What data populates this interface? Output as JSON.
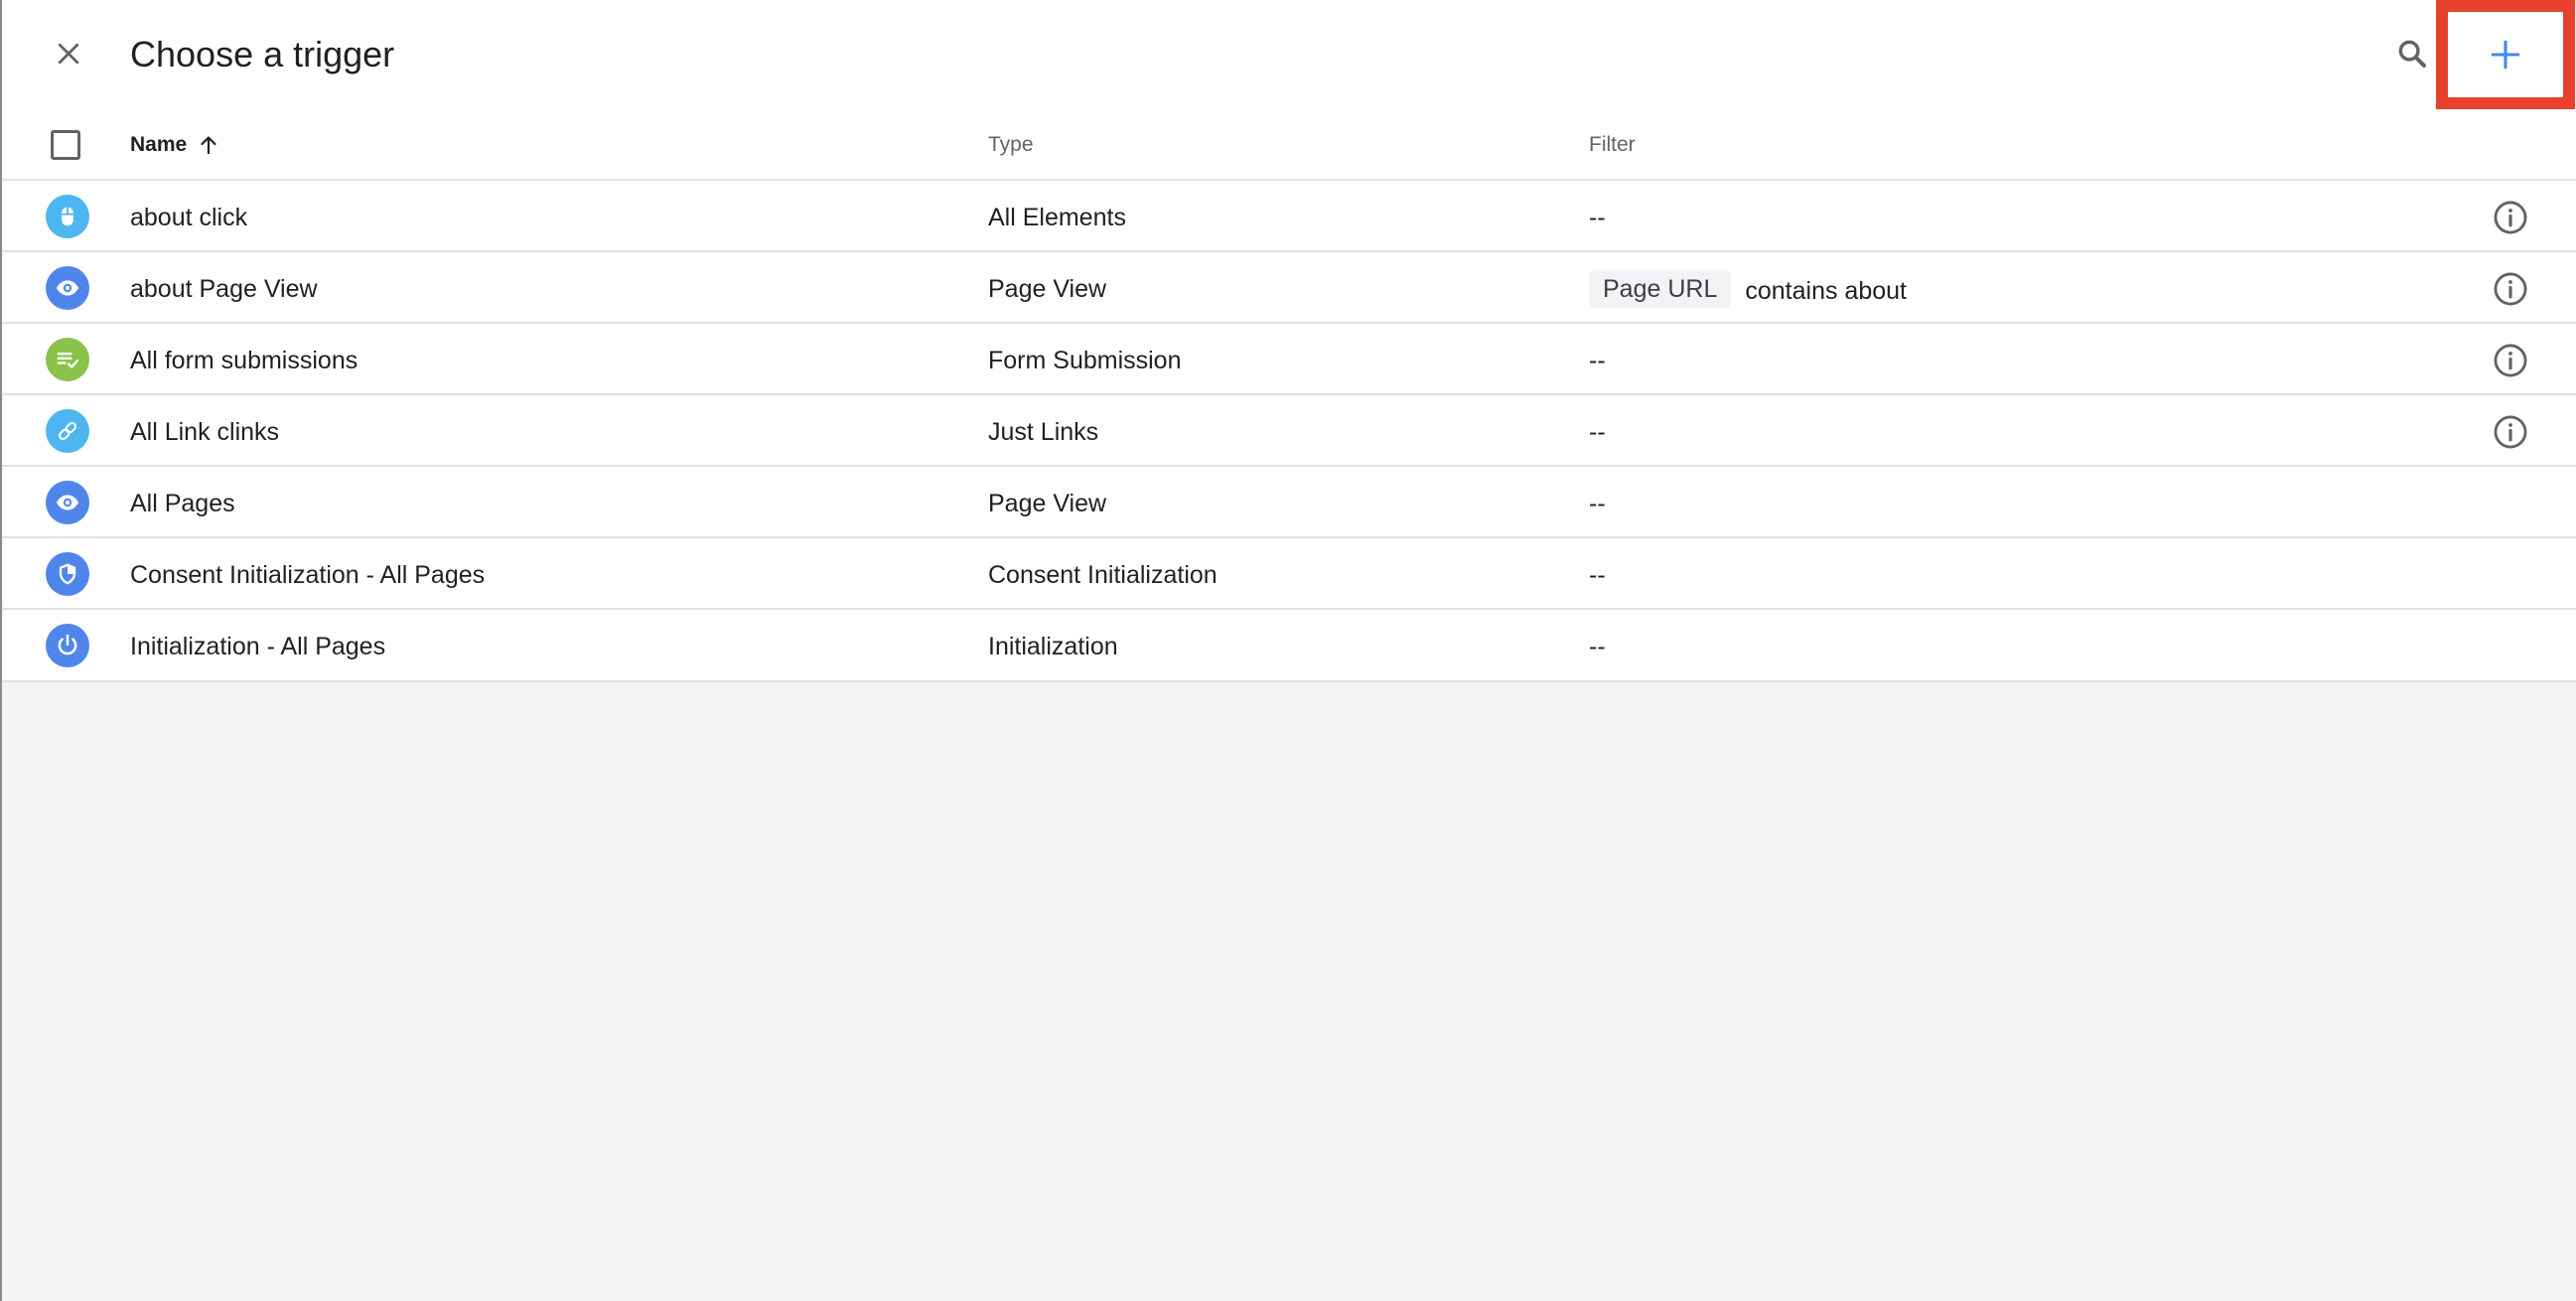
{
  "header": {
    "title": "Choose a trigger",
    "close_icon": "close-icon",
    "search_icon": "search-icon",
    "add_icon": "plus-icon",
    "accent_color": "#4285f4",
    "highlight_color": "#e8412c"
  },
  "table": {
    "columns": {
      "name": "Name",
      "type": "Type",
      "filter": "Filter"
    },
    "sort": "ascending",
    "rows": [
      {
        "name": "about click",
        "type": "All Elements",
        "filter": "--",
        "icon": "mouse-icon",
        "icon_color": "#4db6f0",
        "info": true
      },
      {
        "name": "about Page View",
        "type": "Page View",
        "filter_chip": "Page URL",
        "filter": "contains about",
        "icon": "eye-icon",
        "icon_color": "#4f86ec",
        "info": true
      },
      {
        "name": "All form submissions",
        "type": "Form Submission",
        "filter": "--",
        "icon": "form-check-icon",
        "icon_color": "#8bc34a",
        "info": true
      },
      {
        "name": "All Link clinks",
        "type": "Just Links",
        "filter": "--",
        "icon": "link-icon",
        "icon_color": "#4db6f0",
        "info": true
      },
      {
        "name": "All Pages",
        "type": "Page View",
        "filter": "--",
        "icon": "eye-icon",
        "icon_color": "#4f86ec",
        "info": false
      },
      {
        "name": "Consent Initialization - All Pages",
        "type": "Consent Initialization",
        "filter": "--",
        "icon": "shield-icon",
        "icon_color": "#4f86ec",
        "info": false
      },
      {
        "name": "Initialization - All Pages",
        "type": "Initialization",
        "filter": "--",
        "icon": "power-icon",
        "icon_color": "#4f86ec",
        "info": false
      }
    ]
  }
}
